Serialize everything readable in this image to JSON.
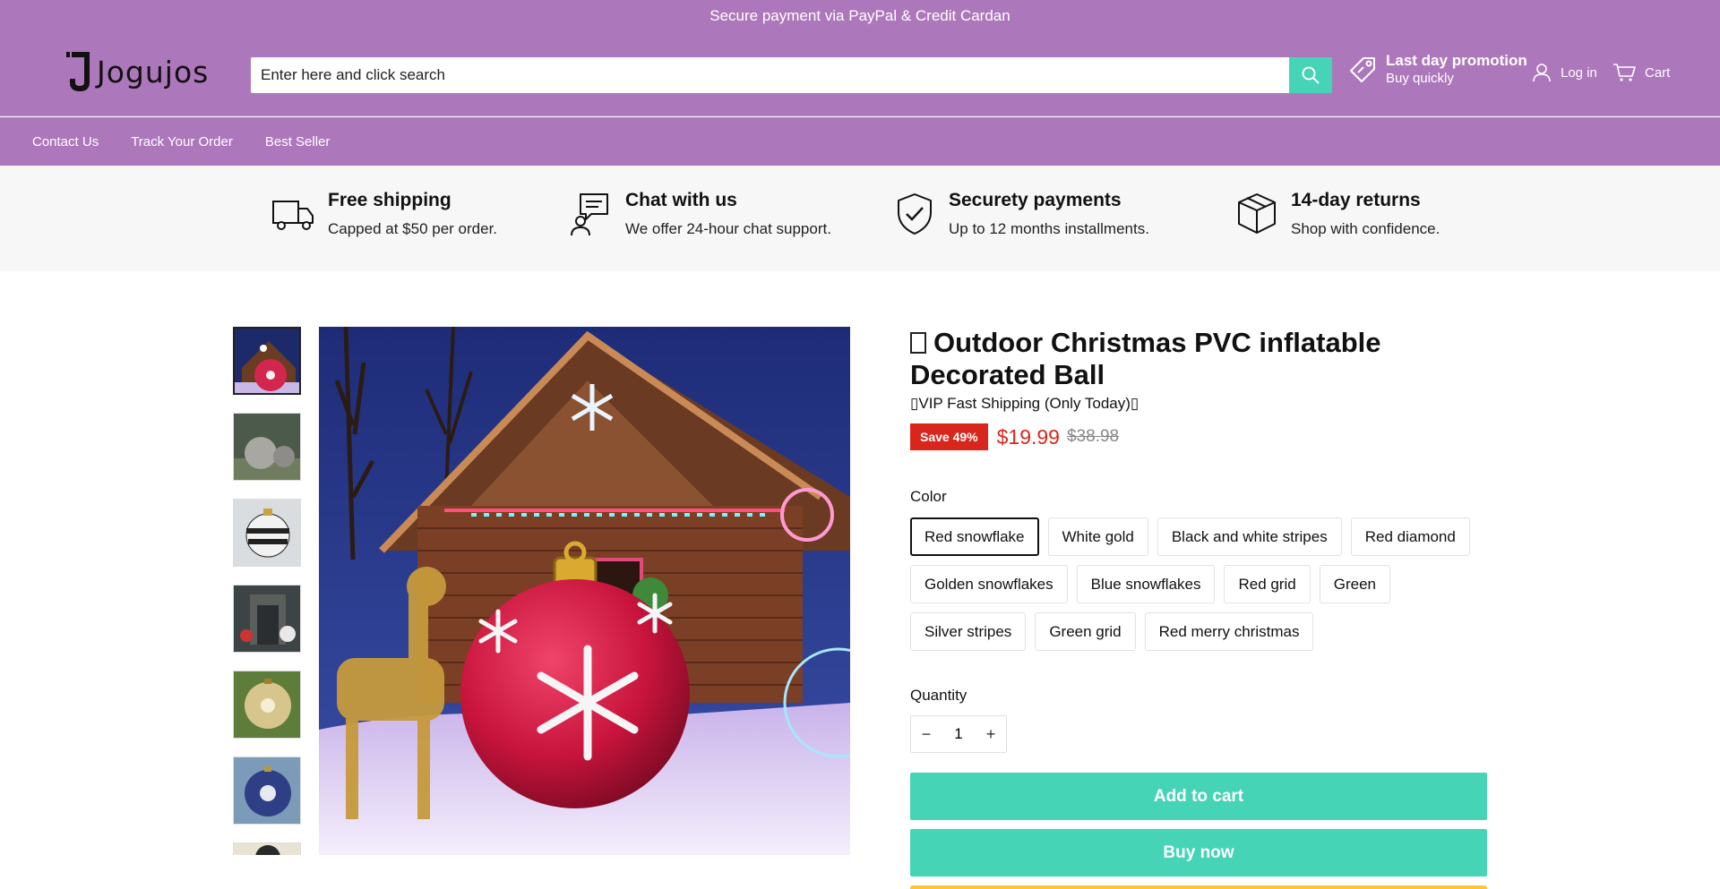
{
  "promo_bar": {
    "text": "Secure payment via PayPal & Credit Cardan"
  },
  "header": {
    "logo_text": "Jogujos",
    "search_placeholder": "Enter here and click search",
    "promotion_title": "Last day promotion",
    "promotion_subtitle": "Buy quickly",
    "login_label": "Log in",
    "cart_label": "Cart",
    "icons": [
      "search-icon",
      "tag-icon",
      "user-icon",
      "cart-icon"
    ]
  },
  "nav": {
    "items": [
      "Contact Us",
      "Track Your Order",
      "Best Seller"
    ]
  },
  "features": [
    {
      "icon": "truck-icon",
      "title": "Free shipping",
      "text": "Capped at $50 per order."
    },
    {
      "icon": "chat-icon",
      "title": "Chat with us",
      "text": "We offer 24-hour chat support."
    },
    {
      "icon": "shield-check-icon",
      "title": "Securety payments",
      "text": "Up to 12 months installments."
    },
    {
      "icon": "box-icon",
      "title": "14-day returns",
      "text": "Shop with confidence."
    }
  ],
  "product": {
    "title": "Outdoor Christmas PVC inflatable Decorated Ball",
    "vip_line": "▯VIP Fast Shipping (Only Today)▯",
    "save_badge": "Save 49%",
    "price": "$19.99",
    "compare_price": "$38.98",
    "color_label": "Color",
    "colors": [
      "Red snowflake",
      "White gold",
      "Black and white stripes",
      "Red diamond",
      "Golden snowflakes",
      "Blue snowflakes",
      "Red grid",
      "Green",
      "Silver stripes",
      "Green grid",
      "Red merry christmas"
    ],
    "selected_color": "Red snowflake",
    "quantity_label": "Quantity",
    "quantity": "1",
    "minus": "−",
    "plus": "+",
    "add_to_cart": "Add to cart",
    "buy_now": "Buy now"
  },
  "colors": {
    "brand": "#ad78bb",
    "accent": "#45d4b5",
    "sale": "#d9261c"
  }
}
